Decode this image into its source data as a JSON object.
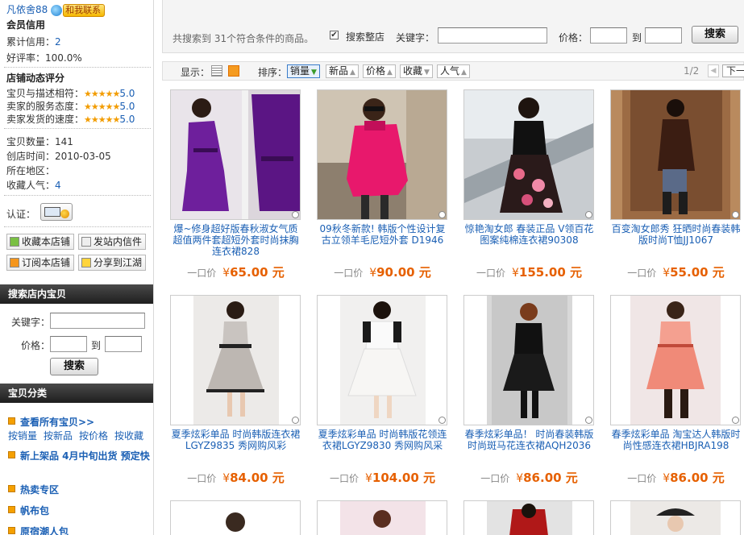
{
  "seller": {
    "name": "凡依舍88",
    "contact_label": "和我联系",
    "credit_title": "会员信用",
    "credit_label": "累计信用：",
    "credit_value": "2",
    "rate_label": "好评率：",
    "rate_value": "100.0%"
  },
  "dsr": {
    "title": "店铺动态评分",
    "items": [
      {
        "label": "宝贝与描述相符：",
        "stars": "★★★★★",
        "score": "5.0"
      },
      {
        "label": "卖家的服务态度：",
        "stars": "★★★★★",
        "score": "5.0"
      },
      {
        "label": "卖家发货的速度：",
        "stars": "★★★★★",
        "score": "5.0"
      }
    ]
  },
  "shop": {
    "count_label": "宝贝数量：",
    "count_value": "141",
    "created_label": "创店时间：",
    "created_value": "2010-03-05",
    "region_label": "所在地区：",
    "region_value": "",
    "fav_label": "收藏人气：",
    "fav_value": "4",
    "cert_label": "认证："
  },
  "actions": {
    "fav": "收藏本店铺",
    "mail": "发站内信件",
    "subscribe": "订阅本店铺",
    "share": "分享到江湖"
  },
  "shop_search": {
    "title": "搜索店内宝贝",
    "keyword_label": "关键字：",
    "price_label": "价格：",
    "to_label": "到",
    "button": "搜索"
  },
  "categories": {
    "title": "宝贝分类",
    "all": "查看所有宝贝>>",
    "sort_links": [
      "按销量",
      "按新品",
      "按价格",
      "按收藏"
    ],
    "items": [
      "新上架品 4月中旬出货 预定快",
      "热卖专区",
      "帆布包",
      "原宿潮人包"
    ]
  },
  "topbar": {
    "result_text": "共搜索到 31个符合条件的商品。",
    "whole_store_label": "搜索整店",
    "keyword_label": "关键字：",
    "price_label": "价格：",
    "to_label": "到",
    "search_button": "搜索"
  },
  "sortbar": {
    "display_label": "显示：",
    "sort_label": "排序：",
    "sorts": [
      "销量",
      "新品",
      "价格",
      "收藏",
      "人气"
    ],
    "page_indicator": "1/2",
    "next_label": "下一页"
  },
  "products": [
    {
      "title": "爆~修身超好版春秋淑女气质超值两件套超短外套时尚抹胸连衣裙828",
      "price_label": "一口价",
      "currency": "¥",
      "price": "65.00 元"
    },
    {
      "title": "09秋冬新款! 韩版个性设计复古立领羊毛尼短外套 D1946",
      "price_label": "一口价",
      "currency": "¥",
      "price": "90.00 元"
    },
    {
      "title": "惊艳淘女郎 春装正品 V领百花图案纯棉连衣裙90308",
      "price_label": "一口价",
      "currency": "¥",
      "price": "155.00 元"
    },
    {
      "title": "百变淘女郎秀 狂晒时尚春装韩版时尚T恤JJ1067",
      "price_label": "一口价",
      "currency": "¥",
      "price": "55.00 元"
    },
    {
      "title": "夏季炫彩单品 时尚韩版连衣裙LGYZ9835 秀网购风彩",
      "price_label": "一口价",
      "currency": "¥",
      "price": "84.00 元"
    },
    {
      "title": "夏季炫彩单品 时尚韩版花领连衣裙LGYZ9830 秀网购风采",
      "price_label": "一口价",
      "currency": "¥",
      "price": "104.00 元"
    },
    {
      "title": "春季炫彩单品！ 时尚春装韩版时尚斑马花连衣裙AQH2036",
      "price_label": "一口价",
      "currency": "¥",
      "price": "86.00 元"
    },
    {
      "title": "春季炫彩单品 淘宝达人韩版时尚性感连衣裙HBJRA198",
      "price_label": "一口价",
      "currency": "¥",
      "price": "86.00 元"
    }
  ],
  "colors": {
    "link": "#1a5fb4",
    "price": "#e66000",
    "star": "#f29c00",
    "dark_header": "#2a2a2a"
  }
}
